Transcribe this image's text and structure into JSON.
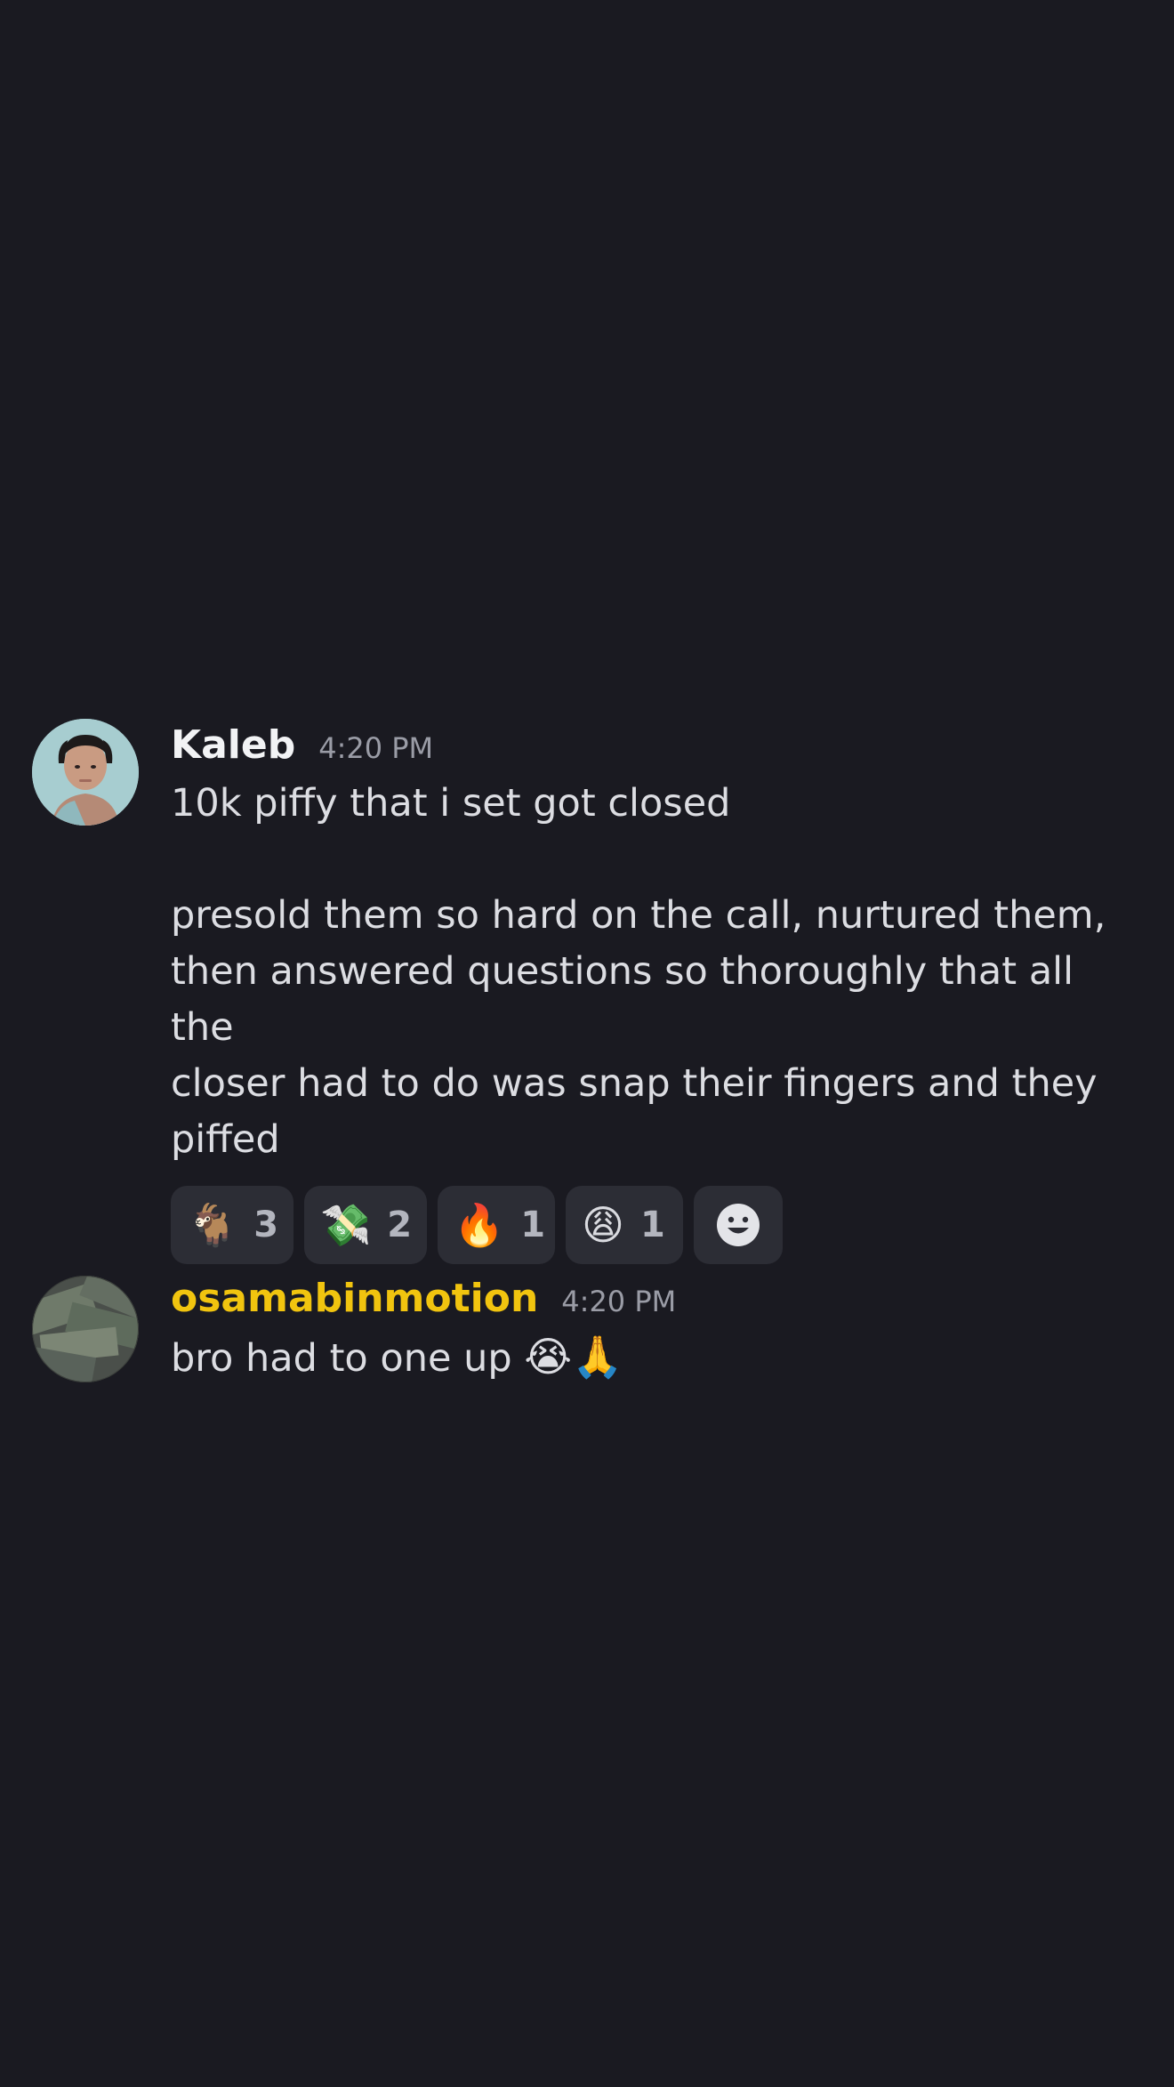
{
  "messages": [
    {
      "author": "Kaleb",
      "author_color": "#f2f3f5",
      "timestamp": "4:20 PM",
      "avatar": "kaleb-avatar",
      "lines": [
        "10k piffy that i set got closed",
        "",
        "presold them so hard on the call, nurtured them,",
        "then answered questions so thoroughly that all the",
        "closer had to do was snap their fingers and they",
        "piffed"
      ],
      "reactions": [
        {
          "emoji": "🐐",
          "icon": "goat-emoji-icon",
          "count": "3"
        },
        {
          "emoji": "💸",
          "icon": "money-with-wings-emoji-icon",
          "count": "2"
        },
        {
          "emoji": "🔥",
          "icon": "fire-emoji-icon",
          "count": "1"
        },
        {
          "emoji": "😩",
          "icon": "weary-face-emoji-icon",
          "count": "1"
        }
      ],
      "add_reaction_icon": "add-reaction-smiley-icon"
    },
    {
      "author": "osamabinmotion",
      "author_color": "#f1c40f",
      "timestamp": "4:20 PM",
      "avatar": "osamabinmotion-avatar",
      "text": "bro had to one up",
      "text_emojis": "😭🙏"
    }
  ],
  "colors": {
    "background": "#1a1a21",
    "reaction_bg": "#2c2d35",
    "timestamp": "#9a9ca6"
  }
}
